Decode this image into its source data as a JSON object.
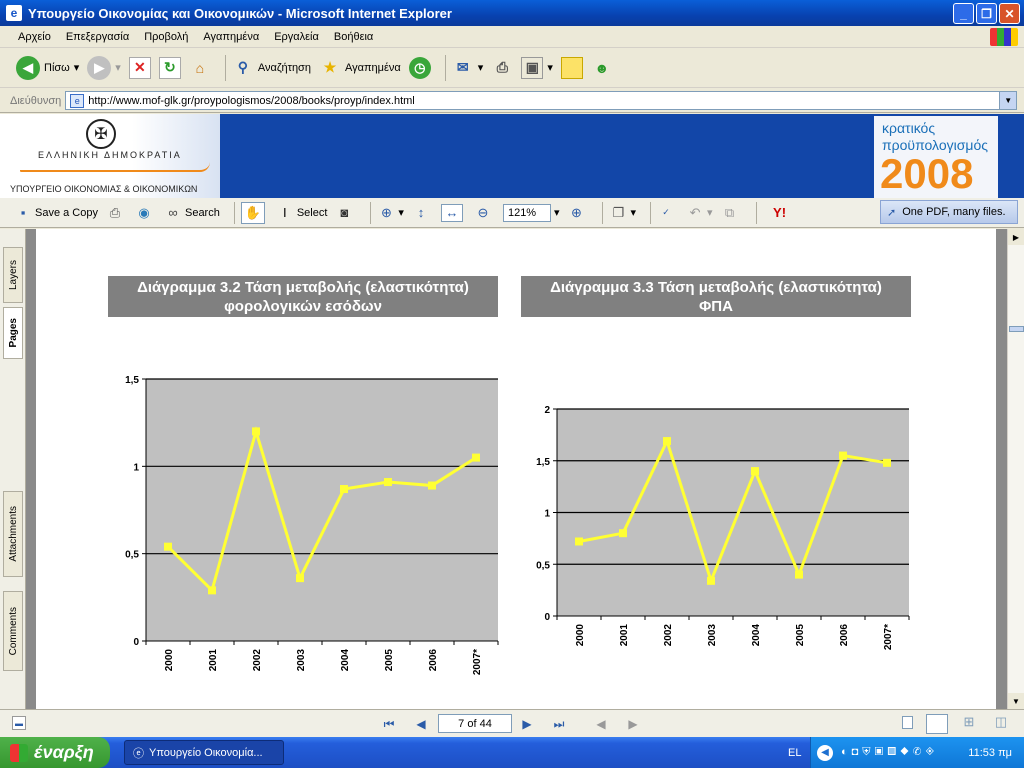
{
  "window": {
    "title": "Υπουργείο Οικονομίας και Οικονομικών - Microsoft Internet Explorer",
    "minimize": "_",
    "maximize": "❐",
    "close": "✕"
  },
  "menu": [
    "Αρχείο",
    "Επεξεργασία",
    "Προβολή",
    "Αγαπημένα",
    "Εργαλεία",
    "Βοήθεια"
  ],
  "ie_toolbar": {
    "back_label": "Πίσω",
    "search_label": "Αναζήτηση",
    "favorites_label": "Αγαπημένα"
  },
  "address": {
    "label": "Διεύθυνση",
    "url": "http://www.mof-glk.gr/proypologismos/2008/books/proyp/index.html"
  },
  "banner": {
    "country": "ΕΛΛΗΝΙΚΗ ΔΗΜΟΚΡΑΤΙΑ",
    "ministry": "ΥΠΟΥΡΓΕΙΟ ΟΙΚΟΝΟΜΙΑΣ & ΟΙΚΟΝΟΜΙΚΩΝ",
    "title_line1": "κρατικός",
    "title_line2": "προϋπολογισμός",
    "year": "2008"
  },
  "acrobat_toolbar": {
    "save_copy": "Save a Copy",
    "search": "Search",
    "select": "Select",
    "zoom": "121%",
    "promo": "One PDF, many files."
  },
  "side_tabs": {
    "layers": "Layers",
    "pages": "Pages",
    "attachments": "Attachments",
    "comments": "Comments"
  },
  "charts": {
    "chart1_title_line1": "Διάγραμμα 3.2  Τάση μεταβολής (ελαστικότητα)",
    "chart1_title_line2": "φορολογικών εσόδων",
    "chart2_title_line1": "Διάγραμμα 3.3  Τάση μεταβολής (ελαστικότητα)",
    "chart2_title_line2": "ΦΠΑ"
  },
  "chart_data": [
    {
      "type": "line",
      "title": "Διάγραμμα 3.2  Τάση μεταβολής (ελαστικότητα) φορολογικών εσόδων",
      "categories": [
        "2000",
        "2001",
        "2002",
        "2003",
        "2004",
        "2005",
        "2006",
        "2007*"
      ],
      "values": [
        0.54,
        0.29,
        1.2,
        0.36,
        0.87,
        0.91,
        0.89,
        1.05
      ],
      "ylim": [
        0,
        1.5
      ],
      "yticks": [
        "0",
        "0,5",
        "1",
        "1,5"
      ],
      "yvals": [
        0,
        0.5,
        1,
        1.5
      ],
      "grid": true,
      "line_color": "#ffff33",
      "plot_bg": "#c0c0c0"
    },
    {
      "type": "line",
      "title": "Διάγραμμα 3.3  Τάση μεταβολής (ελαστικότητα) ΦΠΑ",
      "categories": [
        "2000",
        "2001",
        "2002",
        "2003",
        "2004",
        "2005",
        "2006",
        "2007*"
      ],
      "values": [
        0.72,
        0.8,
        1.69,
        0.34,
        1.4,
        0.4,
        1.55,
        1.48
      ],
      "ylim": [
        0,
        2
      ],
      "yticks": [
        "0",
        "0,5",
        "1",
        "1,5",
        "2"
      ],
      "yvals": [
        0,
        0.5,
        1,
        1.5,
        2
      ],
      "grid": true,
      "line_color": "#ffff33",
      "plot_bg": "#c0c0c0"
    }
  ],
  "navigation": {
    "page_indicator": "7 of 44"
  },
  "taskbar": {
    "start": "έναρξη",
    "task": "Υπουργείο Οικονομία...",
    "language": "EL",
    "clock": "11:53 πμ"
  }
}
